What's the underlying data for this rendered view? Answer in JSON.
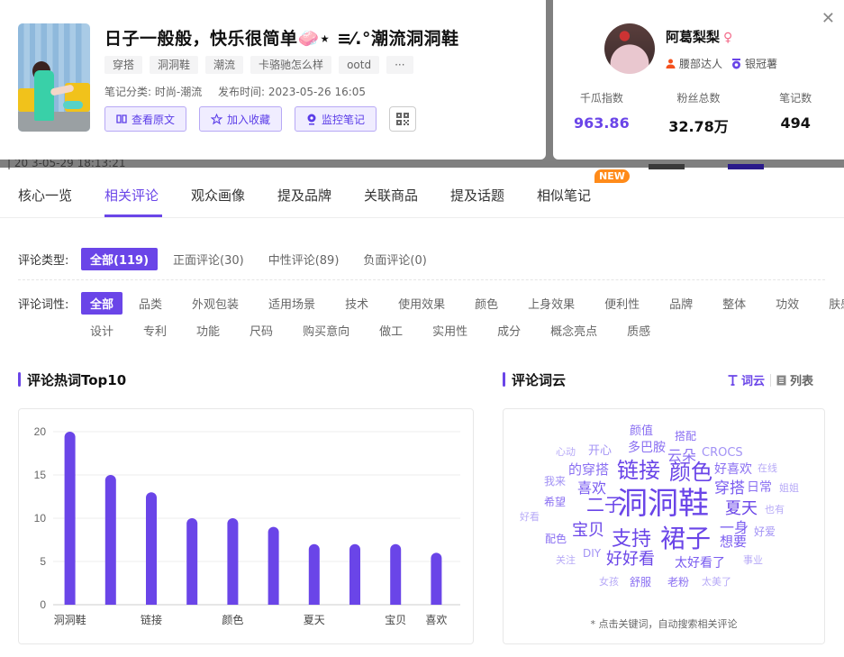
{
  "backdrop": {
    "partial_timestamp": "| 20  3-05-29 18:13:21"
  },
  "note": {
    "title": "日子一般般，快乐很简单🧼⋆ ≡⁄.°潮流洞洞鞋",
    "tags": [
      "穿搭",
      "洞洞鞋",
      "潮流",
      "卡骆驰怎么样",
      "ootd",
      "···"
    ],
    "category_label": "笔记分类: 时尚-潮流",
    "publish_label": "发布时间: 2023-05-26 16:05",
    "actions": {
      "view_original": "查看原文",
      "add_favorite": "加入收藏",
      "monitor": "监控笔记"
    }
  },
  "author": {
    "name": "阿葛梨梨",
    "gender_symbol": "♀",
    "badges": [
      "腰部达人",
      "银冠薯"
    ],
    "stats": [
      {
        "label": "千瓜指数",
        "value": "963.86"
      },
      {
        "label": "粉丝总数",
        "value": "32.78万"
      },
      {
        "label": "笔记数",
        "value": "494"
      }
    ]
  },
  "tabs": [
    {
      "label": "核心一览",
      "active": false
    },
    {
      "label": "相关评论",
      "active": true
    },
    {
      "label": "观众画像",
      "active": false
    },
    {
      "label": "提及品牌",
      "active": false
    },
    {
      "label": "关联商品",
      "active": false
    },
    {
      "label": "提及话题",
      "active": false
    },
    {
      "label": "相似笔记",
      "active": false,
      "badge": "NEW"
    }
  ],
  "filters": {
    "type_label": "评论类型:",
    "types": [
      "全部(119)",
      "正面评论(30)",
      "中性评论(89)",
      "负面评论(0)"
    ],
    "pos_label": "评论词性:",
    "pos_row1": [
      "全部",
      "品类",
      "外观包装",
      "适用场景",
      "技术",
      "使用效果",
      "颜色",
      "上身效果",
      "便利性",
      "品牌",
      "整体",
      "功效",
      "肤感"
    ],
    "pos_row2": [
      "设计",
      "专利",
      "功能",
      "尺码",
      "购买意向",
      "做工",
      "实用性",
      "成分",
      "概念亮点",
      "质感"
    ]
  },
  "hotwords": {
    "title": "评论热词Top10"
  },
  "wordcloud": {
    "title": "评论词云",
    "view_cloud": "词云",
    "view_list": "列表",
    "hint": "* 点击关键词，自动搜索相关评论",
    "words": [
      {
        "text": "洞洞鞋",
        "weight": 1.0
      },
      {
        "text": "链接",
        "weight": 0.75
      },
      {
        "text": "颜色",
        "weight": 0.7
      },
      {
        "text": "裙子",
        "weight": 0.7
      },
      {
        "text": "支持",
        "weight": 0.62
      },
      {
        "text": "二子",
        "weight": 0.58
      },
      {
        "text": "夏天",
        "weight": 0.55
      },
      {
        "text": "好好看",
        "weight": 0.55
      },
      {
        "text": "宝贝",
        "weight": 0.52
      },
      {
        "text": "喜欢",
        "weight": 0.5
      },
      {
        "text": "穿搭",
        "weight": 0.5
      },
      {
        "text": "一身",
        "weight": 0.48
      },
      {
        "text": "想要",
        "weight": 0.45
      },
      {
        "text": "太好看了",
        "weight": 0.45
      },
      {
        "text": "的穿搭",
        "weight": 0.42
      },
      {
        "text": "云朵",
        "weight": 0.42
      },
      {
        "text": "好喜欢",
        "weight": 0.4
      },
      {
        "text": "多巴胺",
        "weight": 0.38
      },
      {
        "text": "日常",
        "weight": 0.38
      },
      {
        "text": "CROCS",
        "weight": 0.35
      },
      {
        "text": "颜值",
        "weight": 0.33
      },
      {
        "text": "搭配",
        "weight": 0.3
      },
      {
        "text": "开心",
        "weight": 0.3
      },
      {
        "text": "我来",
        "weight": 0.3
      },
      {
        "text": "希望",
        "weight": 0.3
      },
      {
        "text": "配色",
        "weight": 0.3
      },
      {
        "text": "舒服",
        "weight": 0.3
      },
      {
        "text": "老粉",
        "weight": 0.3
      },
      {
        "text": "DIY",
        "weight": 0.3
      },
      {
        "text": "好爱",
        "weight": 0.3
      },
      {
        "text": "心动",
        "weight": 0.2
      },
      {
        "text": "在线",
        "weight": 0.2
      },
      {
        "text": "姐姐",
        "weight": 0.2
      },
      {
        "text": "也有",
        "weight": 0.2
      },
      {
        "text": "好看",
        "weight": 0.2
      },
      {
        "text": "关注",
        "weight": 0.2
      },
      {
        "text": "女孩",
        "weight": 0.2
      },
      {
        "text": "太美了",
        "weight": 0.2
      },
      {
        "text": "事业",
        "weight": 0.2
      }
    ]
  },
  "colors": {
    "accent": "#6a45e8",
    "new_badge": "#ff8b1a",
    "gender": "#f36b8a",
    "badge_orange": "#f4511e"
  },
  "chart_data": {
    "type": "bar",
    "title": "评论热词Top10",
    "categories": [
      "洞洞鞋",
      "",
      "链接",
      "",
      "颜色",
      "",
      "夏天",
      "",
      "宝贝",
      "喜欢"
    ],
    "values": [
      20,
      15,
      13,
      10,
      10,
      9,
      7,
      7,
      7,
      6
    ],
    "xlabel": "",
    "ylabel": "",
    "ylim": [
      0,
      20
    ],
    "yticks": [
      0,
      5,
      10,
      15,
      20
    ],
    "grid": true,
    "legend": "none",
    "color": "#6a45e8"
  }
}
